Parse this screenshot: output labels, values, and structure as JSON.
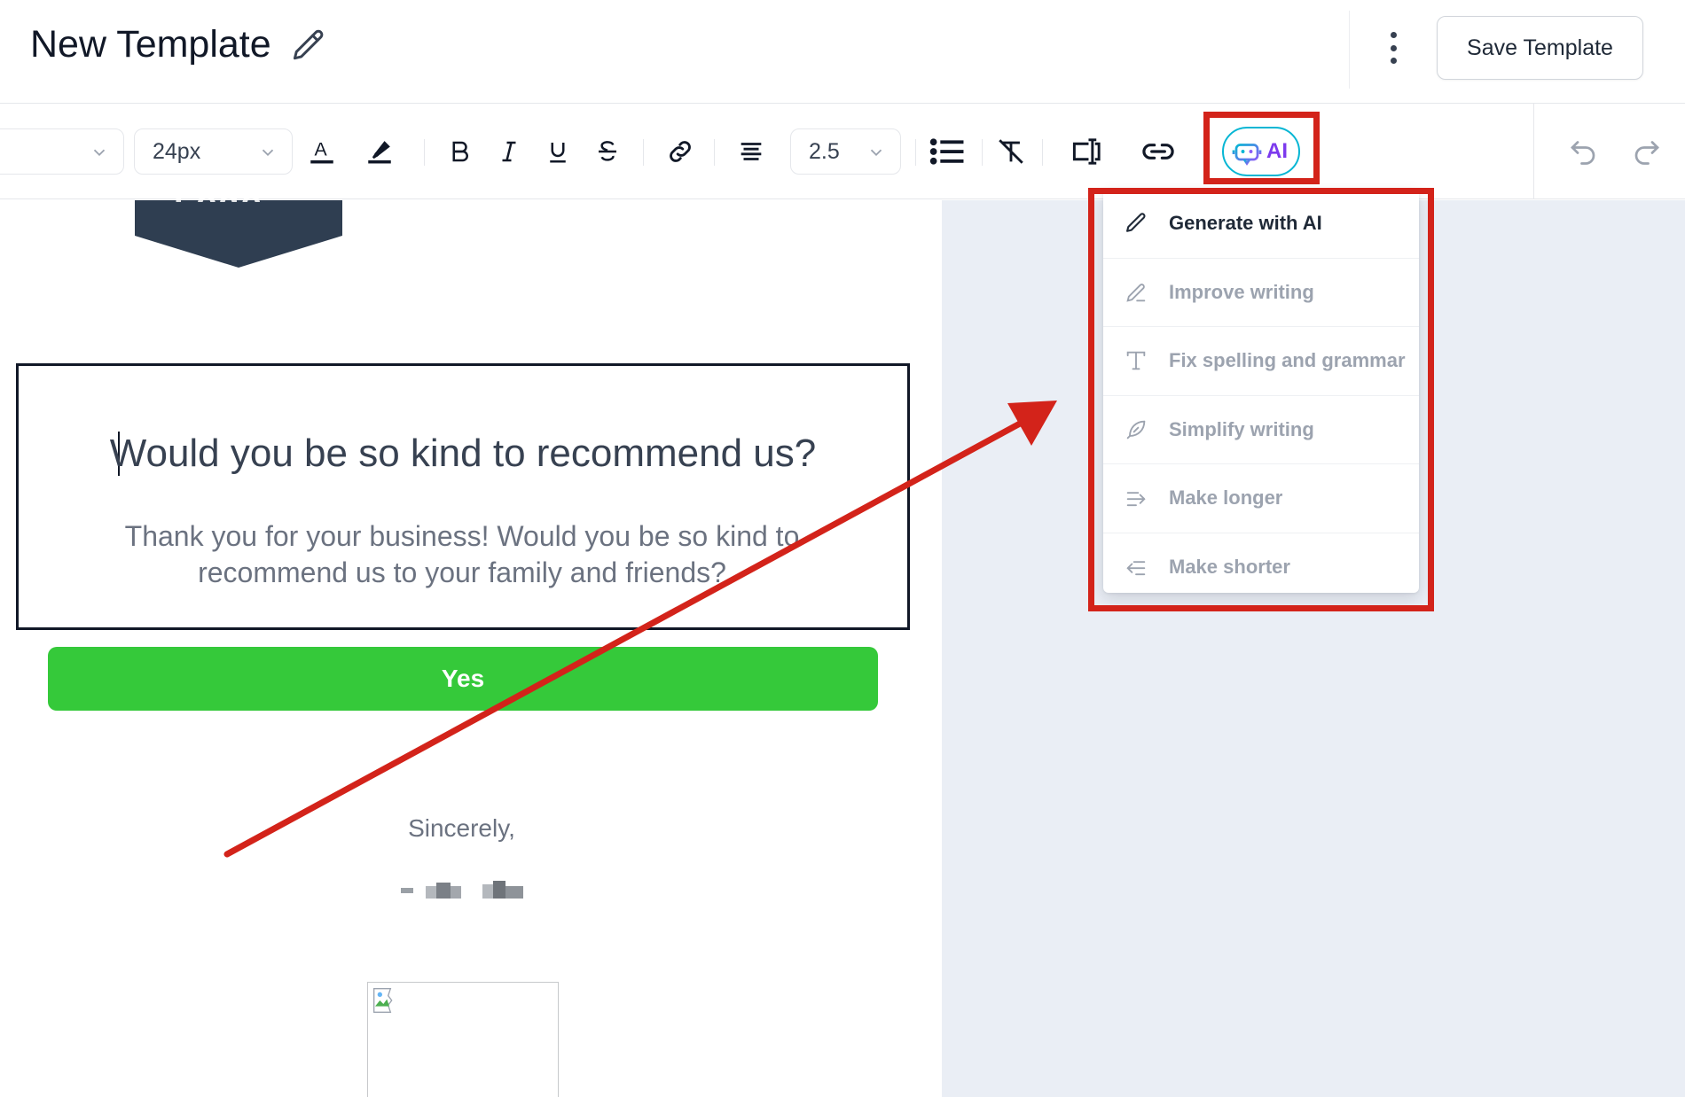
{
  "header": {
    "title": "New Template",
    "save_label": "Save Template"
  },
  "toolbar": {
    "font_size": "24px",
    "line_height": "2.5",
    "ai_label": "AI"
  },
  "email": {
    "logo_text": "Logo",
    "heading": "Would you be so kind to recommend us?",
    "body": "Thank you for your business! Would you be so kind to recommend us to your family and friends?",
    "button_label": "Yes",
    "closing": "Sincerely,"
  },
  "ai_menu": {
    "items": [
      {
        "label": "Generate with AI",
        "icon": "pencil-icon",
        "active": true
      },
      {
        "label": "Improve writing",
        "icon": "pen-nib-icon",
        "active": false
      },
      {
        "label": "Fix spelling and grammar",
        "icon": "text-type-icon",
        "active": false
      },
      {
        "label": "Simplify writing",
        "icon": "feather-icon",
        "active": false
      },
      {
        "label": "Make longer",
        "icon": "arrow-right-lines-icon",
        "active": false
      },
      {
        "label": "Make shorter",
        "icon": "arrow-left-lines-icon",
        "active": false
      }
    ]
  },
  "colors": {
    "accent_green": "#35c93a",
    "annotation_red": "#d3231a",
    "ai_purple": "#7c3aed",
    "ai_cyan": "#06b6d4",
    "canvas_gray": "#eaeef5"
  }
}
